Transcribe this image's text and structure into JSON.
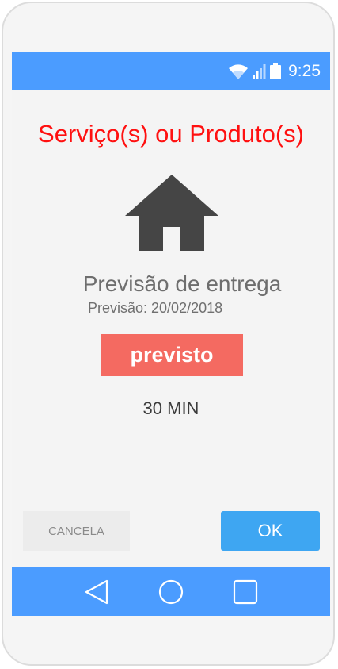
{
  "status_bar": {
    "time": "9:25",
    "icons": [
      "wifi-icon",
      "signal-icon",
      "battery-icon"
    ],
    "color": "#4b9cff"
  },
  "main": {
    "title": "Serviço(s) ou Produto(s)",
    "icon": "house-icon",
    "heading": "Previsão de entrega",
    "date_label": "Previsão: 20/02/2018",
    "status_badge": "previsto",
    "duration": "30 MIN"
  },
  "actions": {
    "cancel_label": "CANCELA",
    "ok_label": "OK"
  },
  "nav_bar": {
    "icons": [
      "back-icon",
      "home-icon",
      "recent-apps-icon"
    ]
  },
  "colors": {
    "title": "#ff1010",
    "badge": "#f46a61",
    "ok_button": "#3ea6f2",
    "bars": "#4b9cff"
  }
}
